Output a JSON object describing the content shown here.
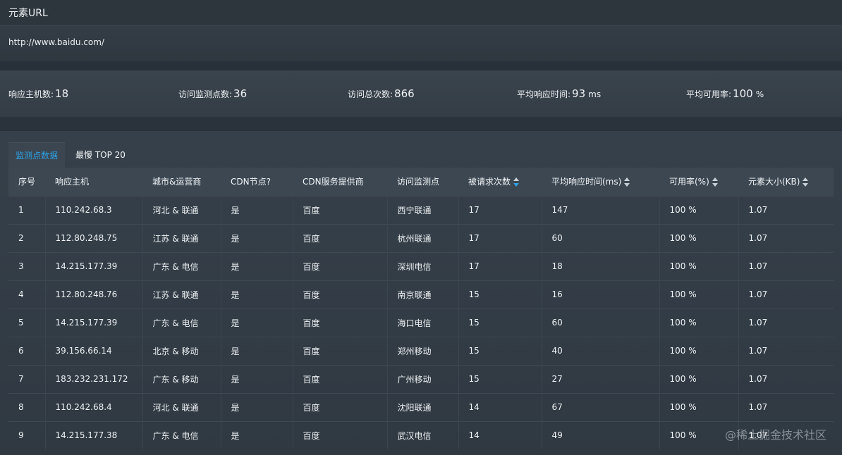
{
  "element_url": {
    "title": "元素URL",
    "value": "http://www.baidu.com/"
  },
  "stats": {
    "hosts_label": "响应主机数:",
    "hosts_value": "18",
    "points_label": "访问监测点数:",
    "points_value": "36",
    "visits_label": "访问总次数:",
    "visits_value": "866",
    "avg_time_label": "平均响应时间:",
    "avg_time_value": "93",
    "avg_time_unit": "ms",
    "avail_label": "平均可用率:",
    "avail_value": "100",
    "avail_unit": "%"
  },
  "tabs": {
    "monitor": "监测点数据",
    "slowest": "最慢 TOP 20"
  },
  "table": {
    "headers": {
      "index": "序号",
      "host": "响应主机",
      "city": "城市&运营商",
      "cdn": "CDN节点?",
      "cdn_provider": "CDN服务提供商",
      "point": "访问监测点",
      "requests": "被请求次数",
      "avg_time": "平均响应时间(ms)",
      "availability": "可用率(%)",
      "size": "元素大小(KB)"
    },
    "rows": [
      {
        "index": "1",
        "host": "110.242.68.3",
        "city": "河北 & 联通",
        "cdn": "是",
        "provider": "百度",
        "point": "西宁联通",
        "requests": "17",
        "avg": "147",
        "avail": "100 %",
        "size": "1.07"
      },
      {
        "index": "2",
        "host": "112.80.248.75",
        "city": "江苏 & 联通",
        "cdn": "是",
        "provider": "百度",
        "point": "杭州联通",
        "requests": "17",
        "avg": "60",
        "avail": "100 %",
        "size": "1.07"
      },
      {
        "index": "3",
        "host": "14.215.177.39",
        "city": "广东 & 电信",
        "cdn": "是",
        "provider": "百度",
        "point": "深圳电信",
        "requests": "17",
        "avg": "18",
        "avail": "100 %",
        "size": "1.07"
      },
      {
        "index": "4",
        "host": "112.80.248.76",
        "city": "江苏 & 联通",
        "cdn": "是",
        "provider": "百度",
        "point": "南京联通",
        "requests": "15",
        "avg": "16",
        "avail": "100 %",
        "size": "1.07"
      },
      {
        "index": "5",
        "host": "14.215.177.39",
        "city": "广东 & 电信",
        "cdn": "是",
        "provider": "百度",
        "point": "海口电信",
        "requests": "15",
        "avg": "60",
        "avail": "100 %",
        "size": "1.07"
      },
      {
        "index": "6",
        "host": "39.156.66.14",
        "city": "北京 & 移动",
        "cdn": "是",
        "provider": "百度",
        "point": "郑州移动",
        "requests": "15",
        "avg": "40",
        "avail": "100 %",
        "size": "1.07"
      },
      {
        "index": "7",
        "host": "183.232.231.172",
        "city": "广东 & 移动",
        "cdn": "是",
        "provider": "百度",
        "point": "广州移动",
        "requests": "15",
        "avg": "27",
        "avail": "100 %",
        "size": "1.07"
      },
      {
        "index": "8",
        "host": "110.242.68.4",
        "city": "河北 & 联通",
        "cdn": "是",
        "provider": "百度",
        "point": "沈阳联通",
        "requests": "14",
        "avg": "67",
        "avail": "100 %",
        "size": "1.07"
      },
      {
        "index": "9",
        "host": "14.215.177.38",
        "city": "广东 & 电信",
        "cdn": "是",
        "provider": "百度",
        "point": "武汉电信",
        "requests": "14",
        "avg": "49",
        "avail": "100 %",
        "size": "1.07"
      }
    ]
  },
  "watermark": "@稀土掘金技术社区",
  "colors": {
    "accent": "#2ea3e6",
    "background": "#323b44"
  }
}
